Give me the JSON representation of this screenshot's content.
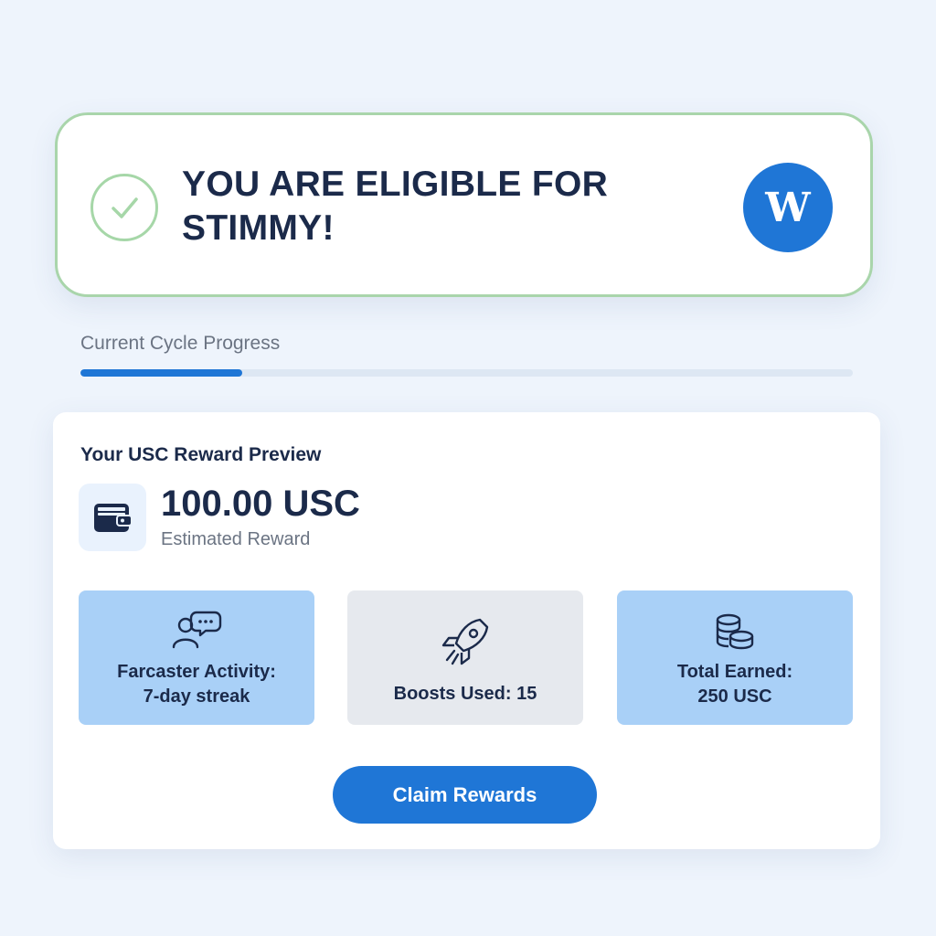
{
  "banner": {
    "title": "YOU ARE ELIGIBLE FOR STIMMY!",
    "logo_letter": "W",
    "check_icon": "check-circle-icon",
    "border_color": "#a9d5ab"
  },
  "progress": {
    "label": "Current Cycle Progress",
    "fraction": 0.21,
    "fill_color": "#1f76d6"
  },
  "reward": {
    "title": "Your USC Reward Preview",
    "amount": "100.00 USC",
    "amount_caption": "Estimated Reward",
    "icon": "wallet-icon"
  },
  "stats": [
    {
      "icon": "chat-users-icon",
      "label_line1": "Farcaster Activity:",
      "label_line2": "7-day streak",
      "color": "#a9d0f7"
    },
    {
      "icon": "rocket-icon",
      "label_line1": "Boosts Used: 15",
      "label_line2": "",
      "color": "#e6e9ee"
    },
    {
      "icon": "coins-icon",
      "label_line1": "Total Earned:",
      "label_line2": "250 USC",
      "color": "#a9d0f7"
    }
  ],
  "claim_button": {
    "label": "Claim Rewards",
    "color": "#1f76d6"
  }
}
